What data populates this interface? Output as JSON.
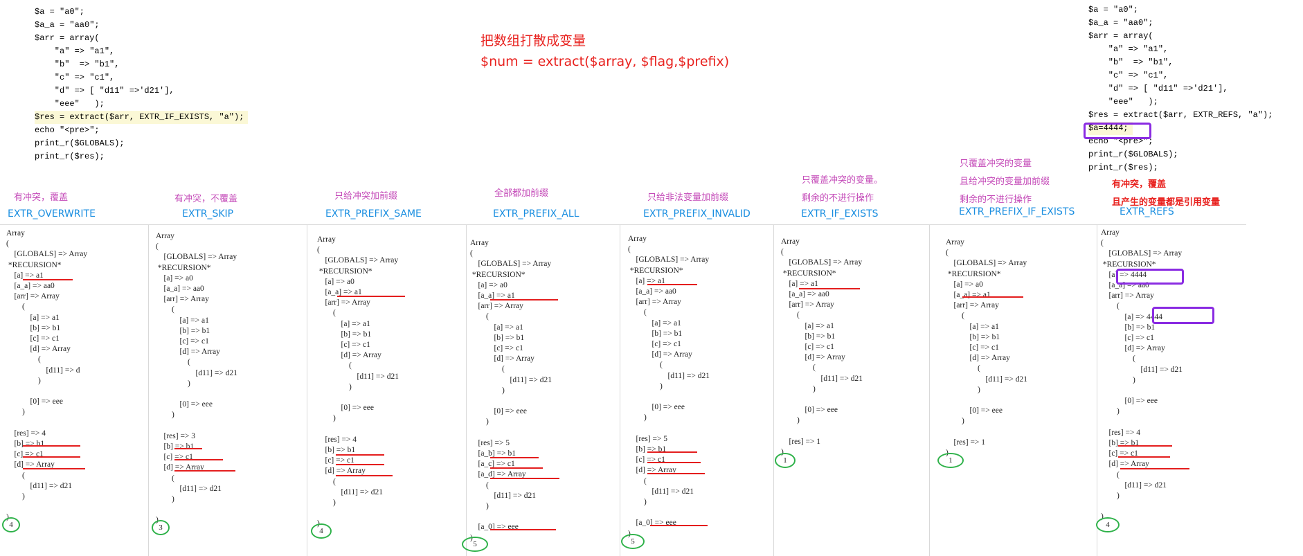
{
  "left_code": {
    "lines": [
      "$a = \"a0\";",
      "$a_a = \"aa0\";",
      "$arr = array(",
      "    \"a\" => \"a1\",",
      "    \"b\"  => \"b1\",",
      "    \"c\" => \"c1\",",
      "    \"d\" => [ \"d11\" =>'d21'],",
      "    \"eee\"   );",
      "$res = extract($arr, EXTR_IF_EXISTS, \"a\");",
      "echo \"<pre>\";",
      "print_r($GLOBALS);",
      "print_r($res);"
    ]
  },
  "right_code": {
    "lines": [
      "$a = \"a0\";",
      "$a_a = \"aa0\";",
      "$arr = array(",
      "    \"a\" => \"a1\",",
      "    \"b\"  => \"b1\",",
      "    \"c\" => \"c1\",",
      "    \"d\" => [ \"d11\" =>'d21'],",
      "    \"eee\"   );",
      "$res = extract($arr, EXTR_REFS, \"a\");",
      "$a=4444;",
      "echo \"<pre>\";",
      "print_r($GLOBALS);",
      "print_r($res);"
    ]
  },
  "heading": {
    "line1": "把数组打散成变量",
    "line2": "$num = extract($array, $flag,$prefix)"
  },
  "columns": [
    {
      "note": [
        "有冲突，覆盖"
      ],
      "flag": "EXTR_OVERWRITE",
      "output": "Array\n(\n    [GLOBALS] => Array\n *RECURSION*\n    [a] => a1\n    [a_a] => aa0\n    [arr] => Array\n        (\n            [a] => a1\n            [b] => b1\n            [c] => c1\n            [d] => Array\n                (\n                    [d11] => d\n                )\n\n            [0] => eee\n        )\n\n    [res] => 4\n    [b] => b1\n    [c] => c1\n    [d] => Array\n        (\n            [d11] => d21\n        )\n\n)",
      "count": "4"
    },
    {
      "note": [
        "有冲突，不覆盖"
      ],
      "flag": "EXTR_SKIP",
      "output": "Array\n(\n    [GLOBALS] => Array\n *RECURSION*\n    [a] => a0\n    [a_a] => aa0\n    [arr] => Array\n        (\n            [a] => a1\n            [b] => b1\n            [c] => c1\n            [d] => Array\n                (\n                    [d11] => d21\n                )\n\n            [0] => eee\n        )\n\n    [res] => 3\n    [b] => b1\n    [c] => c1\n    [d] => Array\n        (\n            [d11] => d21\n        )\n\n)",
      "count": "3"
    },
    {
      "note": [
        "只给冲突加前缀"
      ],
      "flag": "EXTR_PREFIX_SAME",
      "output": "Array\n(\n    [GLOBALS] => Array\n *RECURSION*\n    [a] => a0\n    [a_a] => a1\n    [arr] => Array\n        (\n            [a] => a1\n            [b] => b1\n            [c] => c1\n            [d] => Array\n                (\n                    [d11] => d21\n                )\n\n            [0] => eee\n        )\n\n    [res] => 4\n    [b] => b1\n    [c] => c1\n    [d] => Array\n        (\n            [d11] => d21\n        )\n\n)",
      "count": "4"
    },
    {
      "note": [
        "全部都加前缀"
      ],
      "flag": "EXTR_PREFIX_ALL",
      "output": "Array\n(\n    [GLOBALS] => Array\n *RECURSION*\n    [a] => a0\n    [a_a] => a1\n    [arr] => Array\n        (\n            [a] => a1\n            [b] => b1\n            [c] => c1\n            [d] => Array\n                (\n                    [d11] => d21\n                )\n\n            [0] => eee\n        )\n\n    [res] => 5\n    [a_b] => b1\n    [a_c] => c1\n    [a_d] => Array\n        (\n            [d11] => d21\n        )\n\n    [a_0] => eee\n)",
      "count": "5"
    },
    {
      "note": [
        "只给非法变量加前缀"
      ],
      "flag": "EXTR_PREFIX_INVALID",
      "output": "Array\n(\n    [GLOBALS] => Array\n *RECURSION*\n    [a] => a1\n    [a_a] => aa0\n    [arr] => Array\n        (\n            [a] => a1\n            [b] => b1\n            [c] => c1\n            [d] => Array\n                (\n                    [d11] => d21\n                )\n\n            [0] => eee\n        )\n\n    [res] => 5\n    [b] => b1\n    [c] => c1\n    [d] => Array\n        (\n            [d11] => d21\n        )\n\n    [a_0] => eee\n)",
      "count": "5"
    },
    {
      "note": [
        "只覆盖冲突的变量。",
        "剩余的不进行操作"
      ],
      "flag": "EXTR_IF_EXISTS",
      "output": "Array\n(\n    [GLOBALS] => Array\n *RECURSION*\n    [a] => a1\n    [a_a] => aa0\n    [arr] => Array\n        (\n            [a] => a1\n            [b] => b1\n            [c] => c1\n            [d] => Array\n                (\n                    [d11] => d21\n                )\n\n            [0] => eee\n        )\n\n    [res] => 1\n)",
      "count": "1"
    },
    {
      "note": [
        "只覆盖冲突的变量",
        "且给冲突的变量加前缀",
        "剩余的不进行操作"
      ],
      "flag": "EXTR_PREFIX_IF_EXISTS",
      "output": "Array\n(\n    [GLOBALS] => Array\n *RECURSION*\n    [a] => a0\n    [a_a] => a1\n    [arr] => Array\n        (\n            [a] => a1\n            [b] => b1\n            [c] => c1\n            [d] => Array\n                (\n                    [d11] => d21\n                )\n\n            [0] => eee\n        )\n\n    [res] => 1\n)",
      "count": "1"
    },
    {
      "note": [
        "有冲突，覆盖",
        "且产生的变量都是引用变量"
      ],
      "flag": "EXTR_REFS",
      "output": "Array\n(\n    [GLOBALS] => Array\n *RECURSION*\n    [a] => 4444\n    [a_a] => aa0\n    [arr] => Array\n        (\n            [a] => 4444\n            [b] => b1\n            [c] => c1\n            [d] => Array\n                (\n                    [d11] => d21\n                )\n\n            [0] => eee\n        )\n\n    [res] => 4\n    [b] => b1\n    [c] => c1\n    [d] => Array\n        (\n            [d11] => d21\n        )\n\n)",
      "count": "4"
    }
  ],
  "colors": {
    "heading": "#e8211e",
    "note": "#c44ab8",
    "flag": "#1a8ee0",
    "underline": "#e41e1e",
    "count_circle": "#2fb24a",
    "highlight_box": "#8a2be2"
  }
}
